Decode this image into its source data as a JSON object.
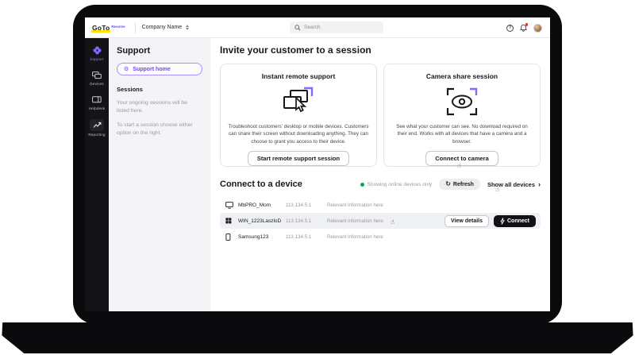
{
  "brand": {
    "logo_text": "GoTo",
    "product_label": "Resolve",
    "company_selector": "Company Name"
  },
  "topbar": {
    "search_placeholder": "Search",
    "help_glyph": "?"
  },
  "icons": {
    "gear": "⚙",
    "refresh": "↻",
    "hand_cursor": "☝",
    "chevron_right": "›"
  },
  "navrail": {
    "items": [
      {
        "label": "Support"
      },
      {
        "label": "Devices"
      },
      {
        "label": "Helpdesk"
      },
      {
        "label": "Reporting"
      }
    ]
  },
  "sidebar": {
    "title": "Support",
    "home_button_label": "Support home",
    "sessions_heading": "Sessions",
    "sessions_line1": "Your ongoing sessions will be listed here.",
    "sessions_line2": "To start a session choose either option on the right."
  },
  "main": {
    "invite_heading": "Invite your customer to a session",
    "cards": [
      {
        "title": "Instant remote support",
        "description": "Troubleshoot customers' desktop or mobile devices. Customers can share their screen without downloading anything. They can choose to grant you access to their device.",
        "button_label": "Start remote support session"
      },
      {
        "title": "Camera share session",
        "description": "See what your customer can see. No download required on their end. Works with all devices that have a camera and a browser.",
        "button_label": "Connect to camera"
      }
    ],
    "devices": {
      "heading": "Connect to a device",
      "status_text": "Showing online devices only",
      "refresh_label": "Refresh",
      "show_all_label": "Show all devices",
      "rows": [
        {
          "name": "MbPRO_Mom",
          "ip": "113.134.5.1",
          "info": "Relevant information here"
        },
        {
          "name": "WIN_1223LaszloD",
          "ip": "113.134.5.1",
          "info": "Relevant information here",
          "view_details_label": "View details",
          "connect_label": "Connect"
        },
        {
          "name": "Samsung123",
          "ip": "113.134.5.1",
          "info": "Relevant information here"
        }
      ]
    }
  },
  "colors": {
    "accent_purple": "#6f46f8",
    "brand_yellow": "#ffe600",
    "status_green": "#12a159",
    "notification_red": "#e8321e"
  }
}
